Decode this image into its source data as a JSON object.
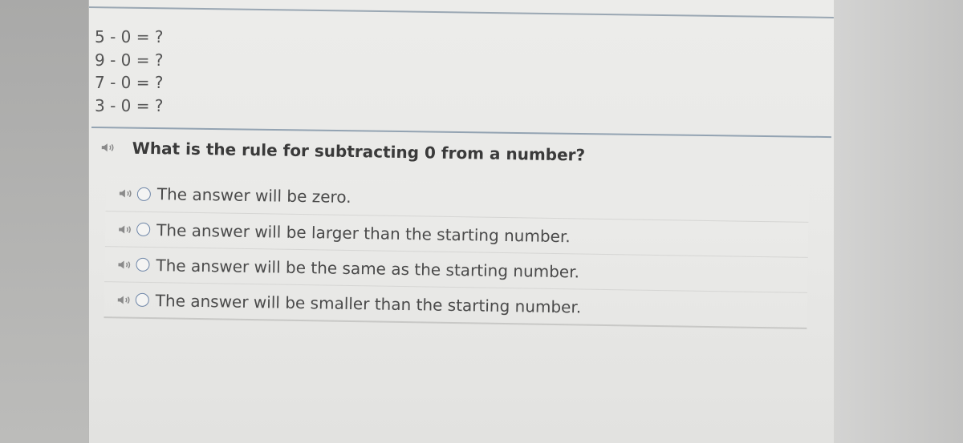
{
  "equations": [
    "5 - 0 = ?",
    "9 - 0 = ?",
    "7 - 0 = ?",
    "3 - 0 = ?"
  ],
  "question": {
    "text": "What is the rule for subtracting 0 from a number?",
    "speaker_icon": "speaker-icon"
  },
  "options": [
    {
      "label": "The answer will be zero.",
      "selected": false
    },
    {
      "label": "The answer will be larger than the starting number.",
      "selected": false
    },
    {
      "label": "The answer will be the same as the starting number.",
      "selected": false
    },
    {
      "label": "The answer will be smaller than the starting number.",
      "selected": false
    }
  ],
  "colors": {
    "rule": "#93a3b2",
    "radio_border": "#6e86a8",
    "text": "#4a4a4a"
  }
}
